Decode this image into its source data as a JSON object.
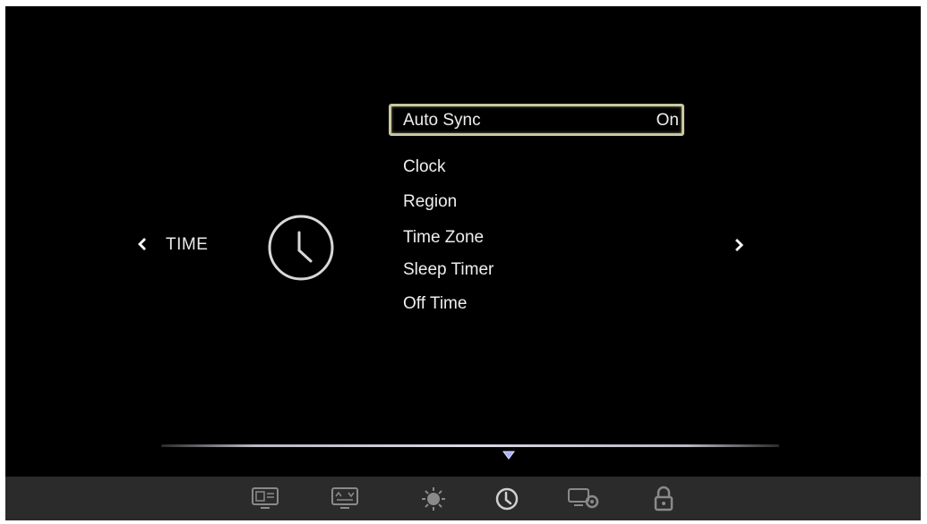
{
  "section": {
    "title": "TIME",
    "icon": "clock-icon",
    "prev_icon": "chevron-left-icon",
    "next_icon": "chevron-right-icon"
  },
  "menu": {
    "items": [
      {
        "label": "Auto Sync",
        "value": "On",
        "selected": true
      },
      {
        "label": "Clock",
        "value": ""
      },
      {
        "label": "Region",
        "value": ""
      },
      {
        "label": "Time Zone",
        "value": ""
      },
      {
        "label": "Sleep Timer",
        "value": ""
      },
      {
        "label": "Off Time",
        "value": ""
      }
    ]
  },
  "bottom_bar": {
    "icons": [
      "picture-icon",
      "screen-icon",
      "sound-icon",
      "time-icon",
      "setup-icon",
      "lock-icon"
    ],
    "active": "time-icon"
  },
  "colors": {
    "background": "#000000",
    "text": "#eeeeee",
    "selection_border": "#c9c7a0",
    "bottom_bar": "#2b2b2b",
    "marker": "#a8b0ff"
  }
}
